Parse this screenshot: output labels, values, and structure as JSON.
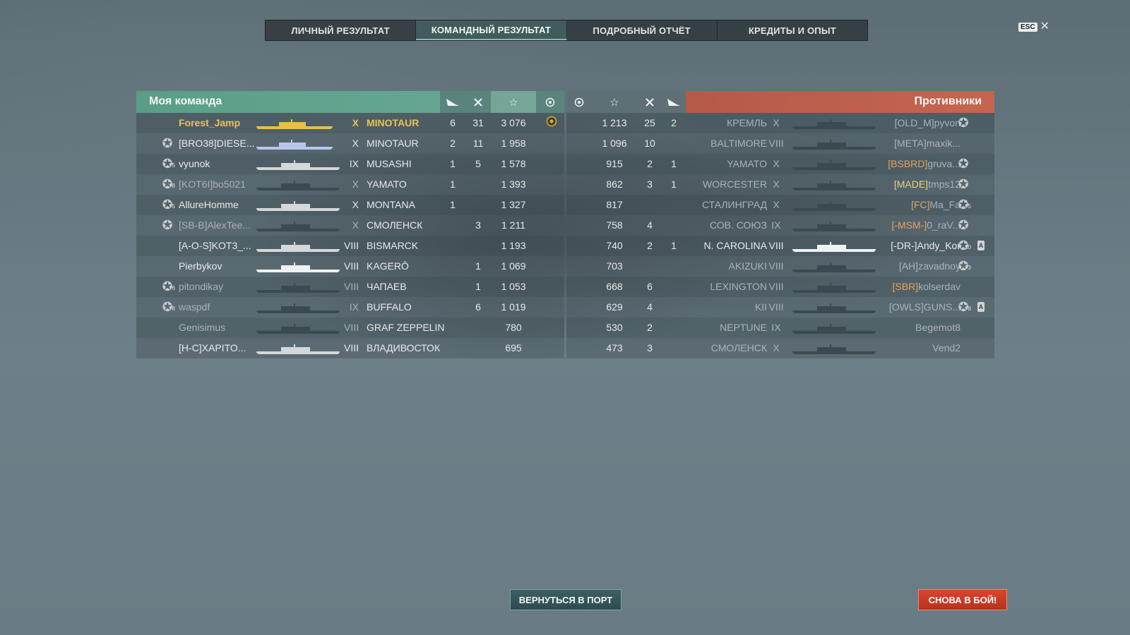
{
  "tabs": [
    {
      "label": "ЛИЧНЫЙ РЕЗУЛЬТАТ"
    },
    {
      "label": "КОМАНДНЫЙ РЕЗУЛЬТАТ",
      "active": true
    },
    {
      "label": "ПОДРОБНЫЙ ОТЧЁТ"
    },
    {
      "label": "КРЕДИТЫ И ОПЫТ"
    }
  ],
  "esc": {
    "key": "ESC",
    "close": "✕"
  },
  "my_team": {
    "title": "Моя команда",
    "header_icons": [
      "plane-kills-icon",
      "kills-icon",
      "experience-star-icon",
      "survived-icon"
    ],
    "players": [
      {
        "clan": "",
        "name": "Forest_Jamp",
        "tier": "X",
        "ship": "MINOTAUR",
        "planes": "6",
        "kills": "31",
        "xp": "3 076",
        "survived": true,
        "highlight": true,
        "rank": "",
        "silhouette": "gold"
      },
      {
        "clan": "[BRO38]",
        "name": "DIESE...",
        "tier": "X",
        "ship": "MINOTAUR",
        "planes": "2",
        "kills": "11",
        "xp": "1 958",
        "rank": "★",
        "silhouette": "blue"
      },
      {
        "clan": "",
        "name": "vyunok",
        "tier": "IX",
        "ship": "MUSASHI",
        "planes": "1",
        "kills": "5",
        "xp": "1 578",
        "rank": "5",
        "silhouette": "light"
      },
      {
        "clan": "[KOT6I]",
        "name": "bo5021",
        "tier": "X",
        "ship": "YAMATO",
        "planes": "1",
        "kills": "",
        "xp": "1 393",
        "rank": "8",
        "silhouette": "dark",
        "dead": true
      },
      {
        "clan": "",
        "name": "AllureHomme",
        "tier": "X",
        "ship": "MONTANA",
        "planes": "1",
        "kills": "",
        "xp": "1 327",
        "rank": "5",
        "silhouette": "light"
      },
      {
        "clan": "[SB-B]",
        "name": "AlexTee...",
        "tier": "X",
        "ship": "СМОЛЕНСК",
        "planes": "",
        "kills": "3",
        "xp": "1 211",
        "rank": "★",
        "silhouette": "dark",
        "dead": true
      },
      {
        "clan": "[A-O-S]",
        "name": "KOT3_...",
        "tier": "VIII",
        "ship": "BISMARCK",
        "planes": "",
        "kills": "",
        "xp": "1 193",
        "rank": "",
        "silhouette": "light"
      },
      {
        "clan": "",
        "name": "Pierbykov",
        "tier": "VIII",
        "ship": "KAGERŌ",
        "planes": "",
        "kills": "1",
        "xp": "1 069",
        "rank": "",
        "silhouette": "white"
      },
      {
        "clan": "",
        "name": "pitondikay",
        "tier": "VIII",
        "ship": "ЧАПАЕВ",
        "planes": "",
        "kills": "1",
        "xp": "1 053",
        "rank": "6",
        "silhouette": "dark",
        "dead": true
      },
      {
        "clan": "",
        "name": "waspdf",
        "tier": "IX",
        "ship": "BUFFALO",
        "planes": "",
        "kills": "6",
        "xp": "1 019",
        "rank": "8",
        "silhouette": "dark",
        "dead": true
      },
      {
        "clan": "",
        "name": "Genisimus",
        "tier": "VIII",
        "ship": "GRAF ZEPPELIN",
        "planes": "",
        "kills": "",
        "xp": "780",
        "rank": "",
        "silhouette": "dark",
        "dead": true
      },
      {
        "clan": "[H-C]",
        "name": "XAPITO...",
        "tier": "VIII",
        "ship": "ВЛАДИВОСТОК",
        "planes": "",
        "kills": "",
        "xp": "695",
        "rank": "",
        "silhouette": "light"
      }
    ]
  },
  "enemy_team": {
    "title": "Противники",
    "header_icons": [
      "survived-icon",
      "experience-star-icon",
      "kills-icon",
      "plane-kills-icon"
    ],
    "players": [
      {
        "xp": "1 213",
        "kills": "25",
        "planes": "2",
        "ship": "КРЕМЛЬ",
        "tier": "X",
        "clan": "[OLD_M]",
        "name": "pyvon",
        "rank": "★",
        "silhouette": "dark",
        "dead": true
      },
      {
        "xp": "1 096",
        "kills": "10",
        "planes": "",
        "ship": "BALTIMORE",
        "tier": "VIII",
        "clan": "[META]",
        "name": "maxik...",
        "rank": "",
        "silhouette": "dark",
        "dead": true
      },
      {
        "xp": "915",
        "kills": "2",
        "planes": "1",
        "ship": "YAMATO",
        "tier": "X",
        "clan": "[BSBRD]",
        "name": "gruva...",
        "rank": "★",
        "silhouette": "dark",
        "dead": true,
        "clan_color": "orange"
      },
      {
        "xp": "862",
        "kills": "3",
        "planes": "1",
        "ship": "WORCESTER",
        "tier": "X",
        "clan": "[MADE]",
        "name": "tmps12",
        "rank": "★",
        "silhouette": "dark",
        "dead": true,
        "clan_color": "yellow"
      },
      {
        "xp": "817",
        "kills": "",
        "planes": "",
        "ship": "СТАЛИНГРАД",
        "tier": "X",
        "clan": "[FC]",
        "name": "Ma_Fa",
        "rank": "5",
        "silhouette": "dark",
        "dead": true,
        "clan_color": "orange"
      },
      {
        "xp": "758",
        "kills": "4",
        "planes": "",
        "ship": "СОВ. СОЮЗ",
        "tier": "IX",
        "clan": "[-MSM-]",
        "name": "0_raV...",
        "rank": "★",
        "silhouette": "dark",
        "dead": true,
        "clan_color": "orange"
      },
      {
        "xp": "740",
        "kills": "2",
        "planes": "1",
        "ship": "N. CAROLINA",
        "tier": "VIII",
        "clan": "[-DR-]",
        "name": "Andy_Kor",
        "rank": "10",
        "silhouette": "white",
        "acc": "A"
      },
      {
        "xp": "703",
        "kills": "",
        "planes": "",
        "ship": "AKIZUKI",
        "tier": "VIII",
        "clan": "[AH]",
        "name": "zavadnoy",
        "rank": "3",
        "silhouette": "dark",
        "dead": true
      },
      {
        "xp": "668",
        "kills": "6",
        "planes": "",
        "ship": "LEXINGTON",
        "tier": "VIII",
        "clan": "[SBR]",
        "name": "kolserdav",
        "rank": "",
        "silhouette": "dark",
        "dead": true,
        "clan_color": "orange"
      },
      {
        "xp": "629",
        "kills": "4",
        "planes": "",
        "ship": "KII",
        "tier": "VIII",
        "clan": "[OWLS]",
        "name": "GUNS...",
        "rank": "8",
        "silhouette": "dark",
        "dead": true,
        "acc": "A"
      },
      {
        "xp": "530",
        "kills": "2",
        "planes": "",
        "ship": "NEPTUNE",
        "tier": "IX",
        "clan": "",
        "name": "Begemot8",
        "rank": "",
        "silhouette": "dark",
        "dead": true
      },
      {
        "xp": "473",
        "kills": "3",
        "planes": "",
        "ship": "СМОЛЕНСК",
        "tier": "X",
        "clan": "",
        "name": "Vend2",
        "rank": "",
        "silhouette": "dark",
        "dead": true
      }
    ]
  },
  "buttons": {
    "return_port": "ВЕРНУТЬСЯ В ПОРТ",
    "battle_again": "СНОВА В БОЙ!"
  },
  "colors": {
    "my_team_header": "#6aa997",
    "enemy_header": "#c4654f",
    "highlight_player": "#e9c15a",
    "battle_button": "#d8452e"
  }
}
